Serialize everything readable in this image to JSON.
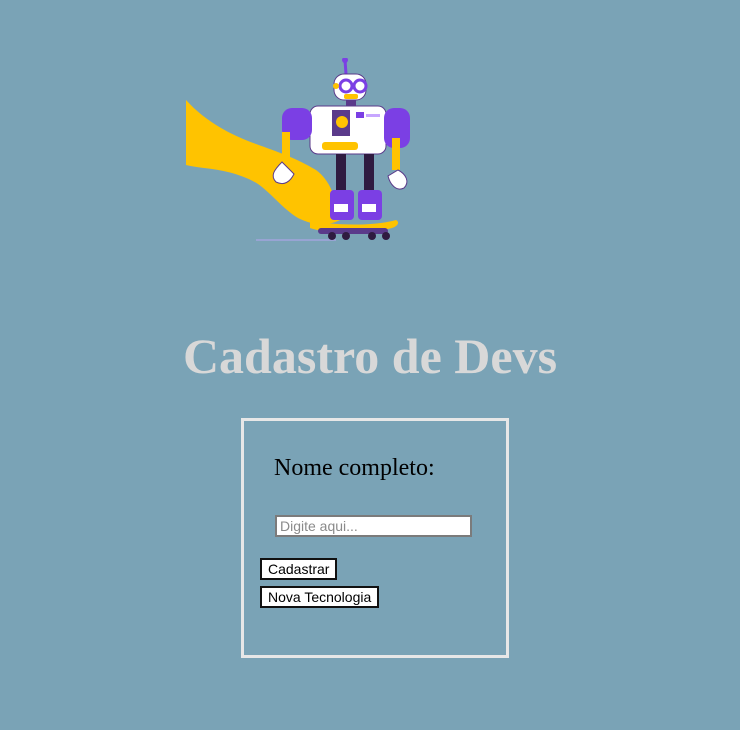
{
  "page": {
    "title": "Cadastro de Devs"
  },
  "hero": {
    "image": "robot-skateboard-illustration"
  },
  "form": {
    "name_label": "Nome completo:",
    "name_value": "",
    "name_placeholder": "Digite aqui...",
    "submit_label": "Cadastrar",
    "new_tech_label": "Nova Tecnologia"
  },
  "colors": {
    "background": "#7aa3b6",
    "title": "#d8d8d8",
    "form_border": "#e7e7e7",
    "robot_purple": "#7b3fe4",
    "robot_yellow": "#ffc300"
  }
}
